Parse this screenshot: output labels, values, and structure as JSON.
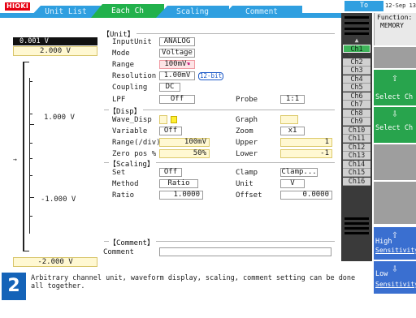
{
  "header": {
    "logo": "HIOKI",
    "tabs": [
      {
        "label": "Unit List"
      },
      {
        "label": "Each Ch"
      },
      {
        "label": "Scaling"
      },
      {
        "label": "Comment"
      }
    ],
    "to_waveform": "To waveform",
    "datetime": "12-Sep 13:31",
    "function_label": "Function:",
    "function_value": "MEMORY"
  },
  "scale": {
    "top_black": "0.001 V",
    "top_value": "2.000 V",
    "mid_upper": "1.000 V",
    "mid_lower": "-1.000 V",
    "bottom_value": "-2.000 V"
  },
  "unit": {
    "title": "【Unit】",
    "input_unit_label": "InputUnit",
    "input_unit": "ANALOG",
    "mode_label": "Mode",
    "mode": "Voltage",
    "range_label": "Range",
    "range": "100mV",
    "resolution_label": "Resolution",
    "resolution": "1.00mV",
    "resolution_bits": "12-bit",
    "coupling_label": "Coupling",
    "coupling": "DC",
    "lpf_label": "LPF",
    "lpf": "Off",
    "probe_label": "Probe",
    "probe": "1:1"
  },
  "disp": {
    "title": "【Disp】",
    "wave_disp_label": "Wave_Disp",
    "graph_label": "Graph",
    "variable_label": "Variable",
    "variable": "Off",
    "zoom_label": "Zoom",
    "zoom": "x1",
    "range_div_label": "Range(/div)",
    "range_div": "100mV",
    "upper_label": "Upper",
    "upper": "1",
    "zero_pos_label": "Zero pos %",
    "zero_pos": "50%",
    "lower_label": "Lower",
    "lower": "-1"
  },
  "scaling": {
    "title": "【Scaling】",
    "set_label": "Set",
    "set": "Off",
    "clamp_label": "Clamp",
    "clamp": "Clamp...",
    "method_label": "Method",
    "method": "Ratio",
    "unit_label": "Unit",
    "unit": "V",
    "ratio_label": "Ratio",
    "ratio": "1.0000",
    "offset_label": "Offset",
    "offset": "0.0000"
  },
  "comment": {
    "title": "【Comment】",
    "comment_label": "Comment",
    "comment_value": ""
  },
  "channels": {
    "items": [
      "Ch1",
      "Ch2",
      "Ch3",
      "Ch4",
      "Ch5",
      "Ch6",
      "Ch7",
      "Ch8",
      "Ch9",
      "Ch10",
      "Ch11",
      "Ch12",
      "Ch13",
      "Ch14",
      "Ch15",
      "Ch16"
    ],
    "selected": "Ch1",
    "scroll_up_icon": "▲",
    "scroll_down_icon": "▼"
  },
  "side": {
    "select_ch_up": "Select Ch",
    "select_ch_down": "Select Ch",
    "high_sens_1": "High",
    "high_sens_2": "Sensitivity",
    "low_sens_1": "Low",
    "low_sens_2": "Sensitivity"
  },
  "help": {
    "step": "2",
    "text": "Arbitrary channel unit, waveform display, scaling, comment setting can be done all together."
  },
  "colors": {
    "accent_blue": "#2f9fe0",
    "selected_tab": "#22b14c",
    "side_button_green": "#28a44d",
    "sensitivity_blue": "#3a6fd0",
    "range_pink": "#fde4e6",
    "wave_color_yellow": "#ffef33"
  }
}
